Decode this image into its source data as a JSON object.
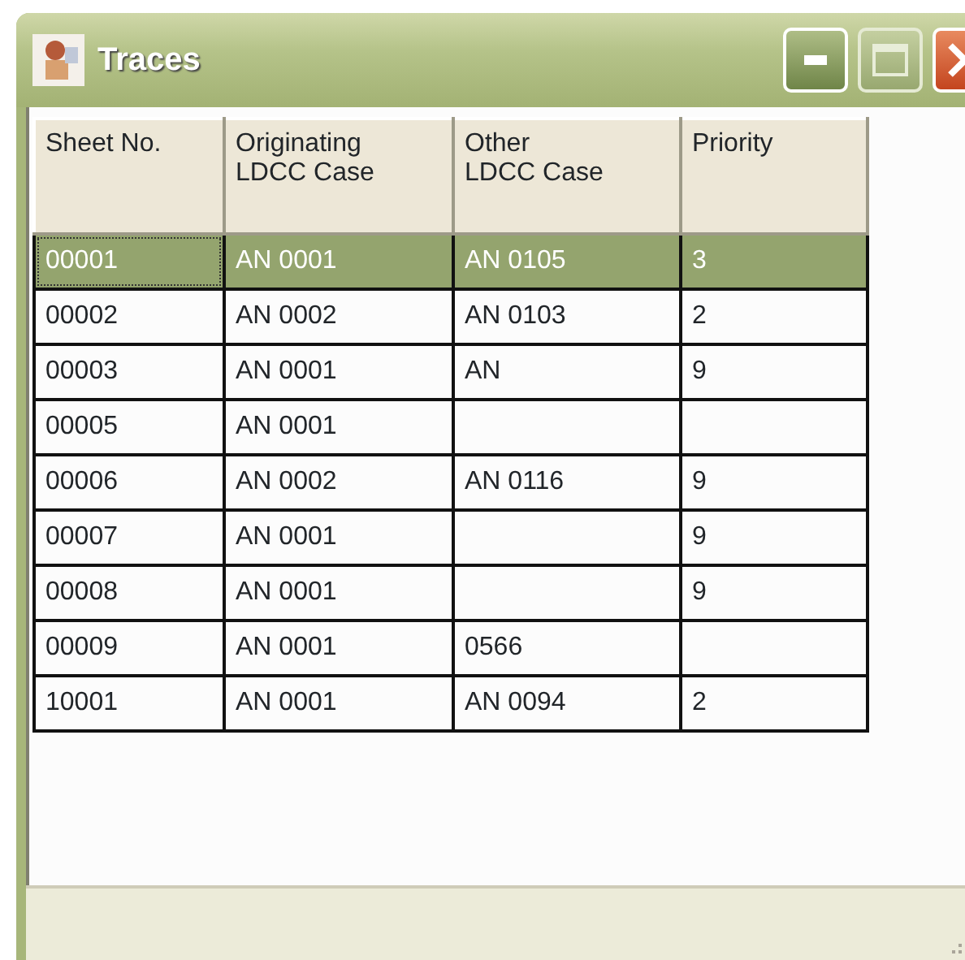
{
  "window": {
    "title": "Traces"
  },
  "table": {
    "columns": [
      "Sheet No.",
      "Originating LDCC Case",
      "Other LDCC Case",
      "Priority"
    ],
    "rows": [
      {
        "selected": true,
        "cells": [
          "00001",
          "AN 0001",
          "AN 0105",
          "3"
        ]
      },
      {
        "selected": false,
        "cells": [
          "00002",
          "AN 0002",
          "AN 0103",
          "2"
        ]
      },
      {
        "selected": false,
        "cells": [
          "00003",
          "AN 0001",
          "AN",
          "9"
        ]
      },
      {
        "selected": false,
        "cells": [
          "00005",
          "AN 0001",
          "",
          ""
        ]
      },
      {
        "selected": false,
        "cells": [
          "00006",
          "AN 0002",
          "AN 0116",
          "9"
        ]
      },
      {
        "selected": false,
        "cells": [
          "00007",
          "AN 0001",
          "",
          "9"
        ]
      },
      {
        "selected": false,
        "cells": [
          "00008",
          "AN 0001",
          "",
          "9"
        ]
      },
      {
        "selected": false,
        "cells": [
          "00009",
          "AN 0001",
          "0566",
          ""
        ]
      },
      {
        "selected": false,
        "cells": [
          "10001",
          "AN 0001",
          "AN 0094",
          "2"
        ]
      }
    ]
  }
}
